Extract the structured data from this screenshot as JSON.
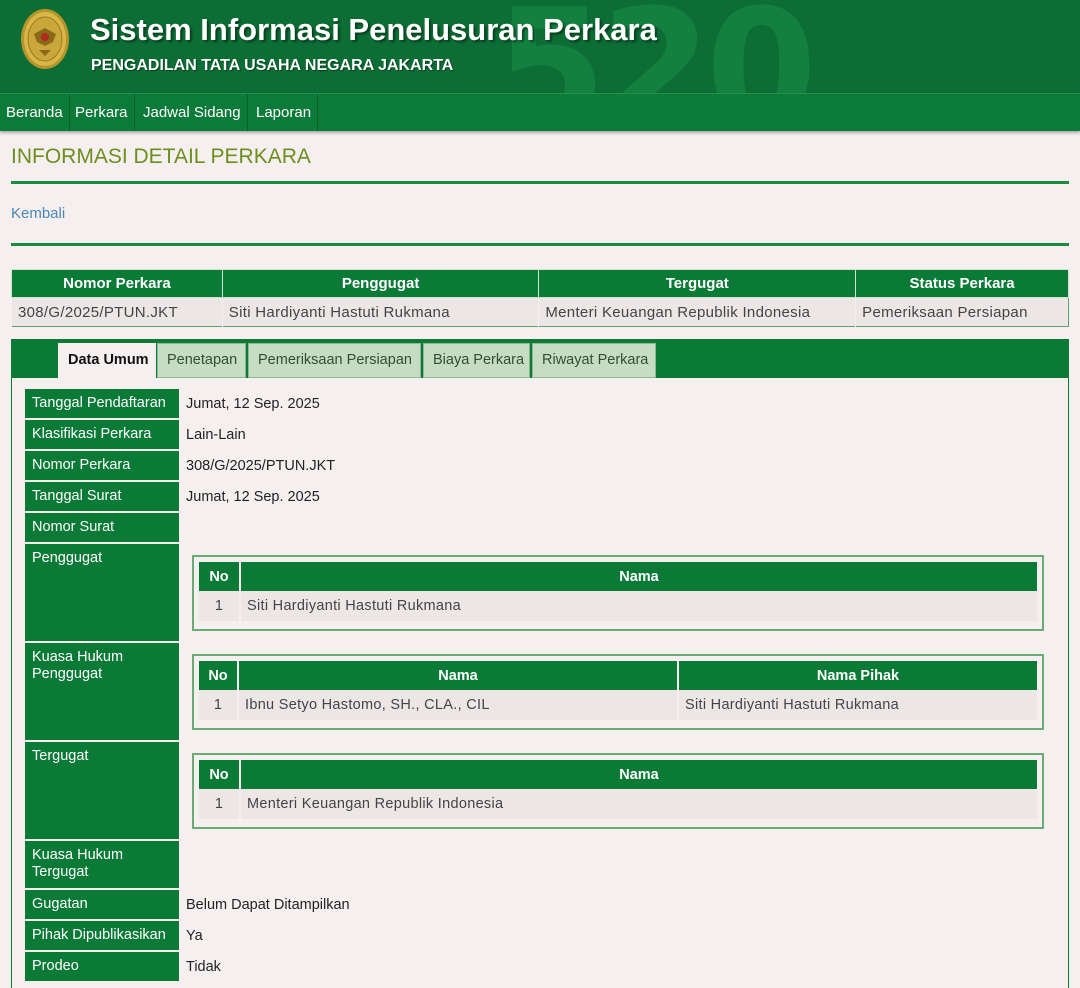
{
  "header": {
    "title": "Sistem Informasi Penelusuran Perkara",
    "subtitle": "PENGADILAN TATA USAHA NEGARA JAKARTA",
    "background_number": "520",
    "logo_icon": "court-emblem-icon"
  },
  "nav": {
    "items": [
      "Beranda",
      "Perkara",
      "Jadwal Sidang",
      "Laporan"
    ]
  },
  "page": {
    "title": "INFORMASI DETAIL PERKARA",
    "back_link": "Kembali"
  },
  "summary": {
    "headers": [
      "Nomor Perkara",
      "Penggugat",
      "Tergugat",
      "Status Perkara"
    ],
    "row": [
      "308/G/2025/PTUN.JKT",
      "Siti Hardiyanti Hastuti Rukmana",
      "Menteri Keuangan Republik Indonesia",
      "Pemeriksaan Persiapan"
    ]
  },
  "tabs": [
    "Data Umum",
    "Penetapan",
    "Pemeriksaan Persiapan",
    "Biaya Perkara",
    "Riwayat Perkara"
  ],
  "active_tab": "Data Umum",
  "detail": {
    "tanggal_pendaftaran": {
      "label": "Tanggal Pendaftaran",
      "value": "Jumat, 12 Sep. 2025"
    },
    "klasifikasi": {
      "label": "Klasifikasi Perkara",
      "value": "Lain-Lain"
    },
    "nomor_perkara": {
      "label": "Nomor Perkara",
      "value": "308/G/2025/PTUN.JKT"
    },
    "tanggal_surat": {
      "label": "Tanggal Surat",
      "value": "Jumat, 12 Sep. 2025"
    },
    "nomor_surat": {
      "label": "Nomor Surat",
      "value": ""
    },
    "penggugat": {
      "label": "Penggugat",
      "headers": [
        "No",
        "Nama"
      ],
      "rows": [
        [
          "1",
          "Siti Hardiyanti Hastuti Rukmana"
        ]
      ]
    },
    "kuasa_penggugat": {
      "label_line1": "Kuasa Hukum",
      "label_line2": "Penggugat",
      "headers": [
        "No",
        "Nama",
        "Nama Pihak"
      ],
      "rows": [
        [
          "1",
          "Ibnu Setyo Hastomo, SH., CLA., CIL",
          "Siti Hardiyanti Hastuti Rukmana"
        ]
      ]
    },
    "tergugat": {
      "label": "Tergugat",
      "headers": [
        "No",
        "Nama"
      ],
      "rows": [
        [
          "1",
          "Menteri Keuangan Republik Indonesia"
        ]
      ]
    },
    "kuasa_tergugat": {
      "label_line1": "Kuasa Hukum",
      "label_line2": "Tergugat"
    },
    "gugatan": {
      "label": "Gugatan",
      "value": "Belum Dapat Ditampilkan"
    },
    "pihak_dipublikasikan": {
      "label": "Pihak Dipublikasikan",
      "value": "Ya"
    },
    "prodeo": {
      "label": "Prodeo",
      "value": "Tidak"
    }
  },
  "colors": {
    "header_green": "#0d6e35",
    "table_green": "#0b7a37",
    "title_olive": "#6d8e1f",
    "link_blue": "#4a86b8"
  }
}
